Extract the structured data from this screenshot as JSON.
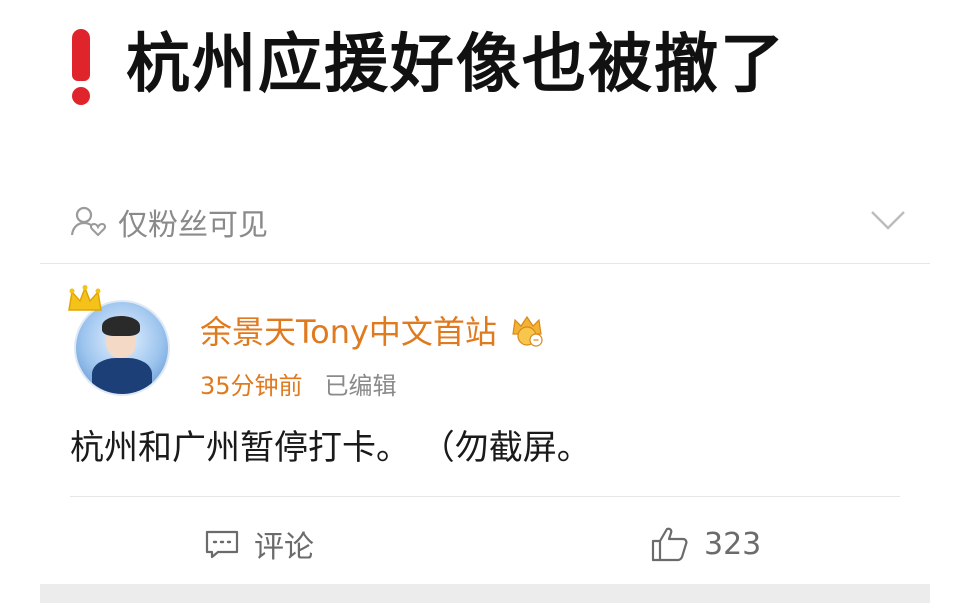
{
  "headline": {
    "icon": "exclamation-icon",
    "text": "杭州应援好像也被撤了",
    "icon_color": "#e0242c"
  },
  "post": {
    "visibility": {
      "icon": "fans-only-icon",
      "label": "仅粉丝可见"
    },
    "author": {
      "name": "余景天Tony中文首站",
      "name_color": "#e07a1f",
      "badge_icon": "vip-crown-icon",
      "avatar_crown_icon": "crown-icon"
    },
    "meta": {
      "time": "35分钟前",
      "edited": "已编辑"
    },
    "content": "杭州和广州暂停打卡。 （勿截屏。",
    "actions": {
      "comment": {
        "icon": "comment-icon",
        "label": "评论"
      },
      "like": {
        "icon": "thumbs-up-icon",
        "count": "323"
      }
    }
  }
}
